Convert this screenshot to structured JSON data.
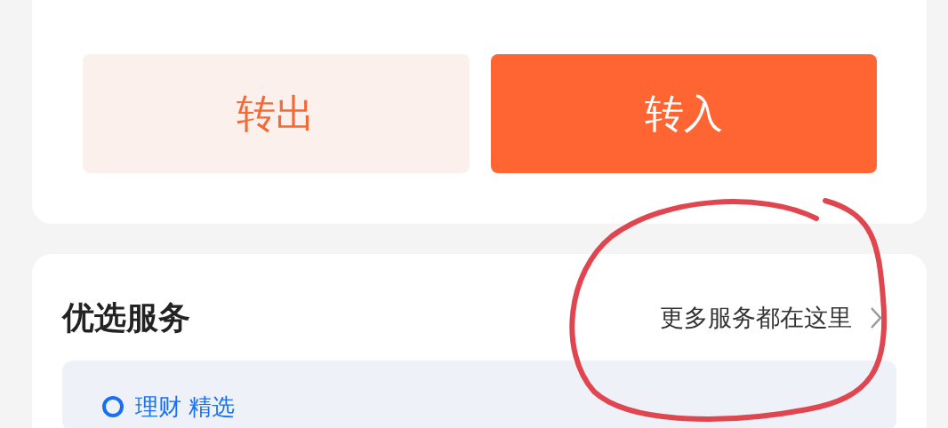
{
  "transfer_card": {
    "buttons": [
      {
        "label": "转出",
        "kind": "secondary"
      },
      {
        "label": "转入",
        "kind": "primary"
      }
    ]
  },
  "services_card": {
    "title": "优选服务",
    "more_link": "更多服务都在这里",
    "section": {
      "label": "理财 精选"
    }
  }
}
